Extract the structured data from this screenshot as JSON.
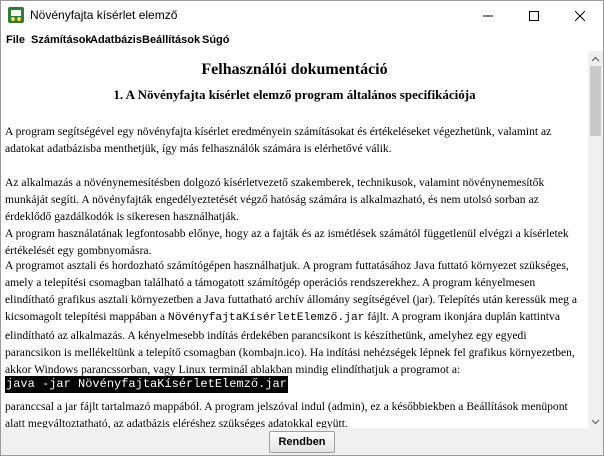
{
  "window": {
    "title": "Növényfajta kísérlet elemző",
    "icon": "app-icon"
  },
  "menu": [
    "File",
    "Számítások",
    "Adatbázis",
    "Beállítások",
    "Súgó"
  ],
  "document": {
    "title": "Felhasználói dokumentáció",
    "section_title": "1. A Növényfajta kísérlet elemző program általános specifikációja",
    "paragraphs": [
      "A program segítségével egy növényfajta kísérlet eredményein számításokat és értékeléseket végezhetünk, valamint az adatokat adatbázisba menthetjük, így más felhasználók számára is elérhetővé válik.",
      "Az alkalmazás a növénynemesítésben dolgozó kísérletvezető szakemberek, technikusok, valamint növénynemesítők munkáját segíti. A növényfajták engedélyeztetését végző hatóság számára is alkalmazható, és nem utolsó sorban az érdeklődő gazdálkodók is sikeresen használhatják.",
      "A program használatának legfontosabb előnye, hogy az a fajták és az ismétlések számától függetlenül elvégzi a kísérletek értékelését egy gombnyomásra."
    ],
    "install_para": {
      "before_jar": "A programot asztali és hordozható számítógépen használhatjuk. A program futtatásához Java futtató környezet szükséges, amely a telepítési csomagban található a támogatott számítógép operációs rendszerekhez. A program kényelmesen elindítható grafikus asztali környezetben a Java futtatható archív állomány segítségével (jar). Telepítés után keressük meg a kicsomagolt telepítési mappában a ",
      "jar_name": "NövényfajtaKísérletElemző.jar",
      "after_jar": " fájlt. A program ikonjára duplán kattintva elindítható az alkalmazás. A kényelmesebb indítás érdekében parancsikont is készíthetünk, amelyhez egy egyedi parancsikon is mellékeltünk a telepítő csomagban (kombajn.ico). Ha indítási nehézségek lépnek fel grafikus környezetben, akkor Windows parancssorban, vagy Linux terminál ablakban mindig elindíthatjuk a programot a:"
    },
    "command": "java -jar NövényfajtaKísérletElemző.jar",
    "final_para": "paranccsal a jar fájlt tartalmazó mappából. A program jelszóval indul (admin), ez a későbbiekben a Beállítások menüpont alatt megváltoztatható, az adatbázis eléréshez szükséges adatokkal együtt."
  },
  "buttons": {
    "close": "Rendben"
  }
}
